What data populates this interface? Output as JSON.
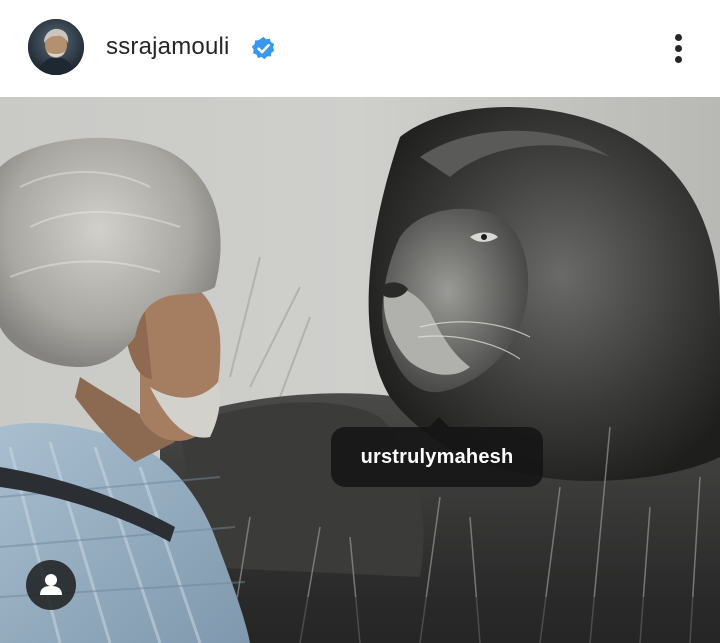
{
  "post": {
    "author": {
      "username": "ssrajamouli",
      "verified": true,
      "avatar_icon": "profile-photo"
    },
    "menu_icon": "more-vertical-icon",
    "media": {
      "type": "photo",
      "tag": {
        "username": "urstrulymahesh"
      },
      "user_tags_icon": "person-icon"
    }
  },
  "colors": {
    "verified_blue": "#3897f0",
    "text_primary": "#262626",
    "tooltip_bg": "#141414",
    "background": "#ffffff"
  }
}
